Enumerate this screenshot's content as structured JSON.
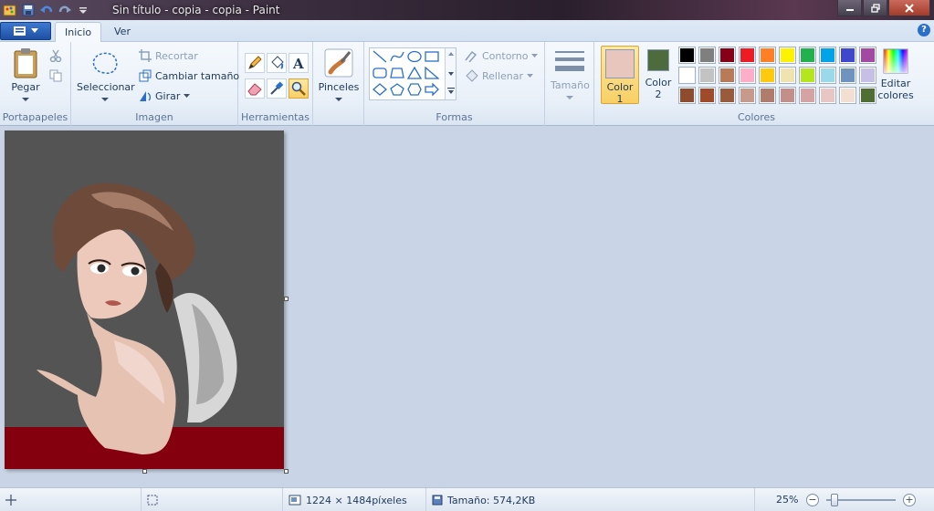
{
  "window": {
    "title": "Sin título - copia - copia - Paint"
  },
  "tabs": [
    {
      "label": "Inicio",
      "active": true
    },
    {
      "label": "Ver",
      "active": false
    }
  ],
  "groups": {
    "portapapeles": {
      "label": "Portapapeles",
      "paste": "Pegar"
    },
    "imagen": {
      "label": "Imagen",
      "select": "Seleccionar",
      "crop": "Recortar",
      "resize": "Cambiar tamaño",
      "rotate": "Girar"
    },
    "herramientas": {
      "label": "Herramientas"
    },
    "pinceles": {
      "label": "Pinceles"
    },
    "formas": {
      "label": "Formas",
      "outline": "Contorno",
      "fill": "Rellenar"
    },
    "tamano": {
      "label": "Tamaño"
    },
    "colores": {
      "label": "Colores",
      "color1": "Color",
      "color1_num": "1",
      "color2": "Color",
      "color2_num": "2",
      "edit": "Editar",
      "edit2": "colores",
      "color1_value": "#e8c6bd",
      "color2_value": "#4d6b3c",
      "palette_row1": [
        "#000000",
        "#7f7f7f",
        "#880015",
        "#ed1c24",
        "#ff7f27",
        "#fff200",
        "#22b14c",
        "#00a2e8",
        "#3f48cc",
        "#a349a4"
      ],
      "palette_row2": [
        "#ffffff",
        "#c3c3c3",
        "#b97a57",
        "#ffaec9",
        "#ffc90e",
        "#efe4b0",
        "#b5e61d",
        "#99d9ea",
        "#7092be",
        "#c8bfe7"
      ],
      "palette_row3": [
        "#8f4b2e",
        "#a04a2a",
        "#9a5a3c",
        "#c89a8c",
        "#b07c6c",
        "#c48f8a",
        "#d6a3a5",
        "#e8c6c3",
        "#f2dfd2",
        "#4f6e34"
      ]
    }
  },
  "status": {
    "dimensions": "1224 × 1484píxeles",
    "size": "Tamaño: 574,2KB",
    "zoom": "25%"
  }
}
